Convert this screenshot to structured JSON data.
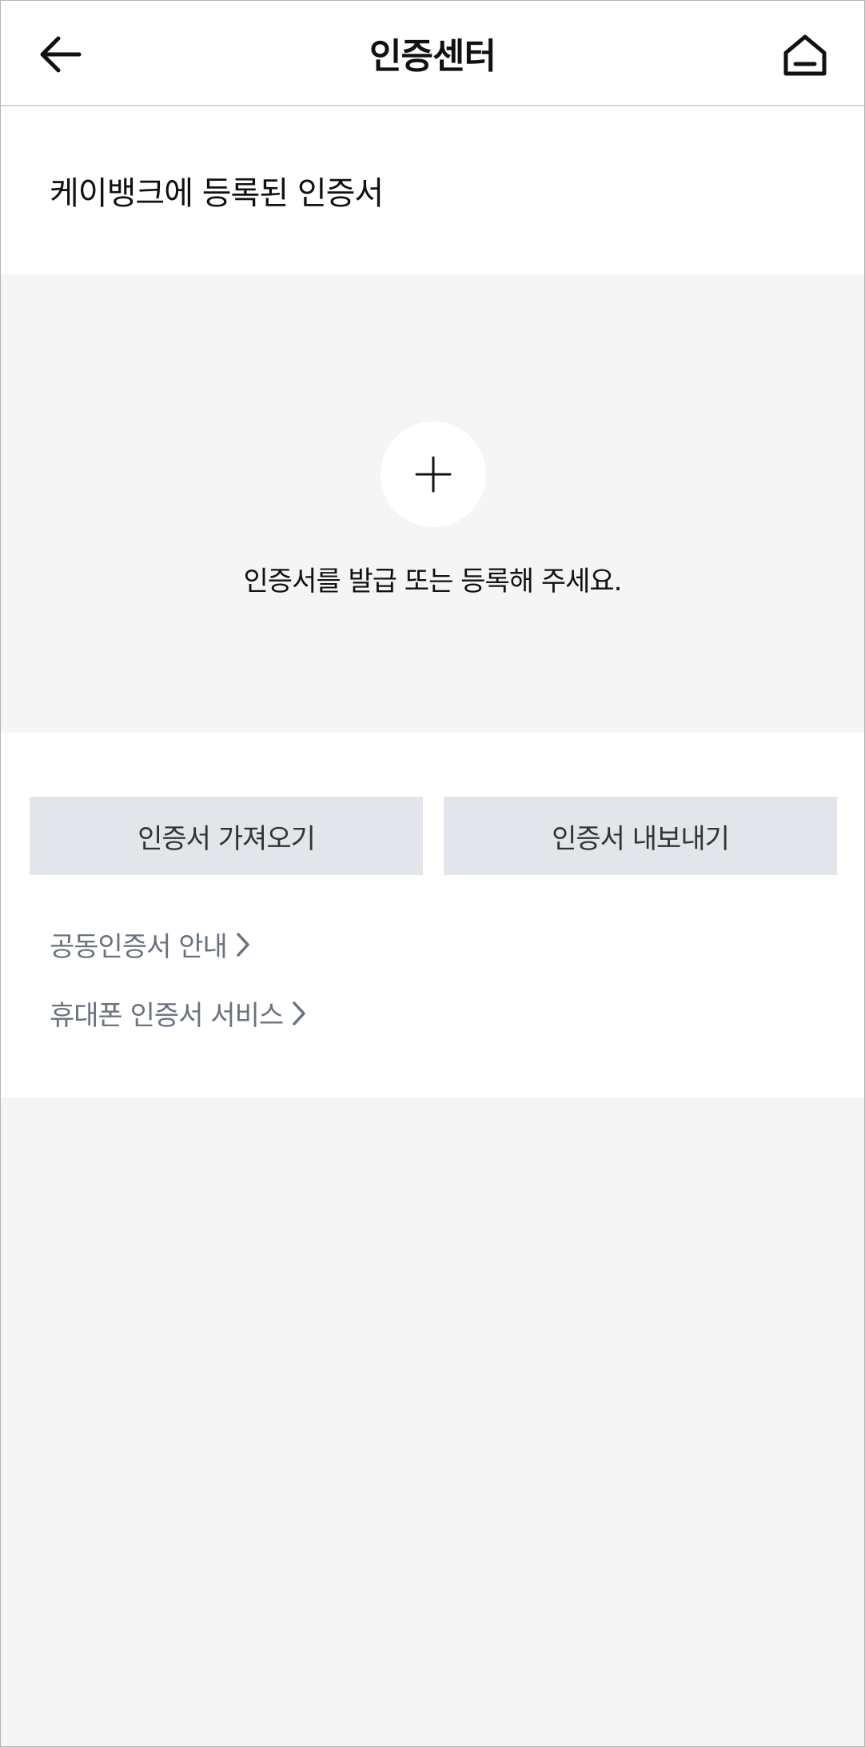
{
  "header": {
    "title": "인증센터",
    "back_icon": "arrow-left-icon",
    "home_icon": "home-icon"
  },
  "section": {
    "heading": "케이뱅크에 등록된 인증서"
  },
  "empty_state": {
    "add_icon": "plus-icon",
    "message": "인증서를 발급 또는 등록해 주세요."
  },
  "actions": {
    "import_label": "인증서 가져오기",
    "export_label": "인증서 내보내기"
  },
  "links": [
    {
      "label": "공동인증서 안내",
      "icon": "chevron-right-icon"
    },
    {
      "label": "휴대폰 인증서 서비스",
      "icon": "chevron-right-icon"
    }
  ],
  "colors": {
    "background": "#f5f5f5",
    "button_bg": "#e2e5ea",
    "link_text": "#6b7280"
  }
}
